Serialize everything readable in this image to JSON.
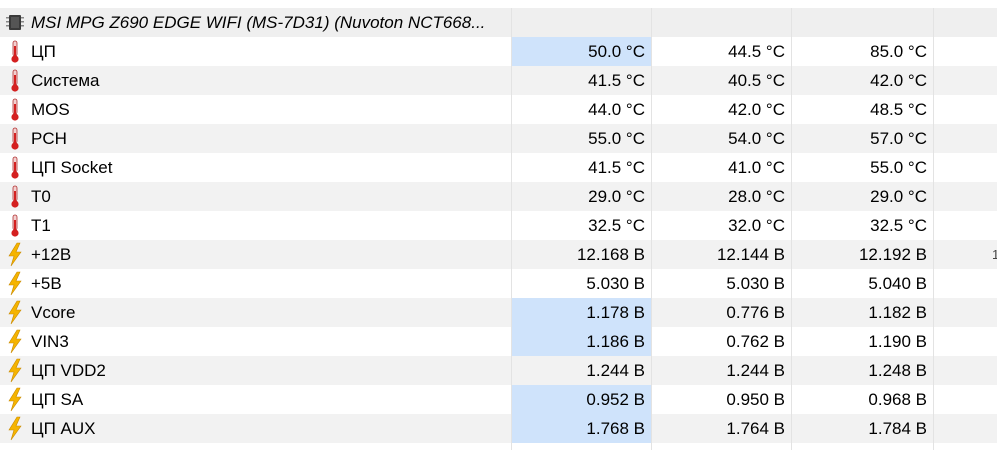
{
  "device_header": {
    "label": "MSI MPG Z690 EDGE WIFI (MS-7D31) (Nuvoton NCT668...",
    "icon": "chip-icon"
  },
  "sensors": [
    {
      "name": "ЦП",
      "icon": "thermometer-icon",
      "current": "50.0 °C",
      "min": "44.5 °C",
      "max": "85.0 °C",
      "highlight": true
    },
    {
      "name": "Система",
      "icon": "thermometer-icon",
      "current": "41.5 °C",
      "min": "40.5 °C",
      "max": "42.0 °C",
      "highlight": false
    },
    {
      "name": "MOS",
      "icon": "thermometer-icon",
      "current": "44.0 °C",
      "min": "42.0 °C",
      "max": "48.5 °C",
      "highlight": false
    },
    {
      "name": "PCH",
      "icon": "thermometer-icon",
      "current": "55.0 °C",
      "min": "54.0 °C",
      "max": "57.0 °C",
      "highlight": false
    },
    {
      "name": "ЦП Socket",
      "icon": "thermometer-icon",
      "current": "41.5 °C",
      "min": "41.0 °C",
      "max": "55.0 °C",
      "highlight": false
    },
    {
      "name": "T0",
      "icon": "thermometer-icon",
      "current": "29.0 °C",
      "min": "28.0 °C",
      "max": "29.0 °C",
      "highlight": false
    },
    {
      "name": "T1",
      "icon": "thermometer-icon",
      "current": "32.5 °C",
      "min": "32.0 °C",
      "max": "32.5 °C",
      "highlight": false
    },
    {
      "name": "+12В",
      "icon": "lightning-icon",
      "current": "12.168 В",
      "min": "12.144 В",
      "max": "12.192 В",
      "highlight": false,
      "overflow": "1"
    },
    {
      "name": "+5В",
      "icon": "lightning-icon",
      "current": "5.030 В",
      "min": "5.030 В",
      "max": "5.040 В",
      "highlight": false
    },
    {
      "name": "Vcore",
      "icon": "lightning-icon",
      "current": "1.178 В",
      "min": "0.776 В",
      "max": "1.182 В",
      "highlight": true
    },
    {
      "name": "VIN3",
      "icon": "lightning-icon",
      "current": "1.186 В",
      "min": "0.762 В",
      "max": "1.190 В",
      "highlight": true
    },
    {
      "name": "ЦП VDD2",
      "icon": "lightning-icon",
      "current": "1.244 В",
      "min": "1.244 В",
      "max": "1.248 В",
      "highlight": false
    },
    {
      "name": "ЦП SA",
      "icon": "lightning-icon",
      "current": "0.952 В",
      "min": "0.950 В",
      "max": "0.968 В",
      "highlight": true
    },
    {
      "name": "ЦП AUX",
      "icon": "lightning-icon",
      "current": "1.768 В",
      "min": "1.764 В",
      "max": "1.784 В",
      "highlight": true
    }
  ],
  "colors": {
    "highlight": "#cfe3fb",
    "alt_row": "#f2f2f2",
    "thermometer": "#d42020",
    "lightning": "#f5b400"
  }
}
